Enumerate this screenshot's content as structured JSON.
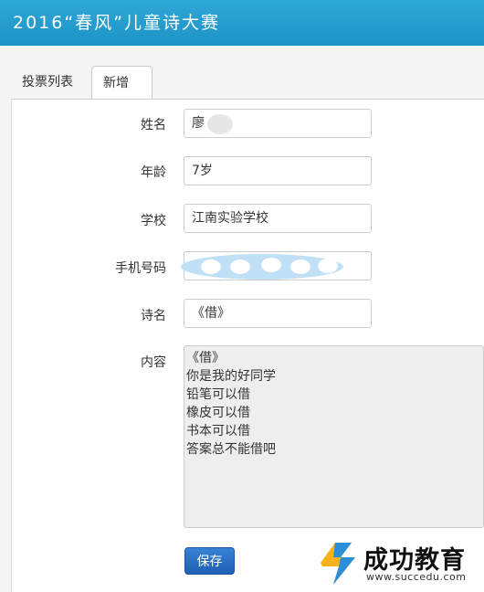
{
  "header": {
    "title": "2016“春风”儿童诗大赛"
  },
  "tabs": [
    {
      "label": "投票列表"
    },
    {
      "label": "新增"
    }
  ],
  "form": {
    "name_label": "姓名",
    "name_value": "廖",
    "age_label": "年龄",
    "age_value": "7岁",
    "school_label": "学校",
    "school_value": "江南实验学校",
    "phone_label": "手机号码",
    "poem_label": "诗名",
    "poem_value": "《借》",
    "content_label": "内容",
    "content_lines": [
      "《借》",
      "你是我的好同学",
      "铅笔可以借",
      "橡皮可以借",
      "书本可以借",
      "答案总不能借吧"
    ],
    "save_label": "保存"
  },
  "watermark": {
    "brand": "成功教育",
    "url": "www.succedu.com"
  },
  "colors": {
    "header": "#1c93c6",
    "button": "#1e5fb4"
  }
}
